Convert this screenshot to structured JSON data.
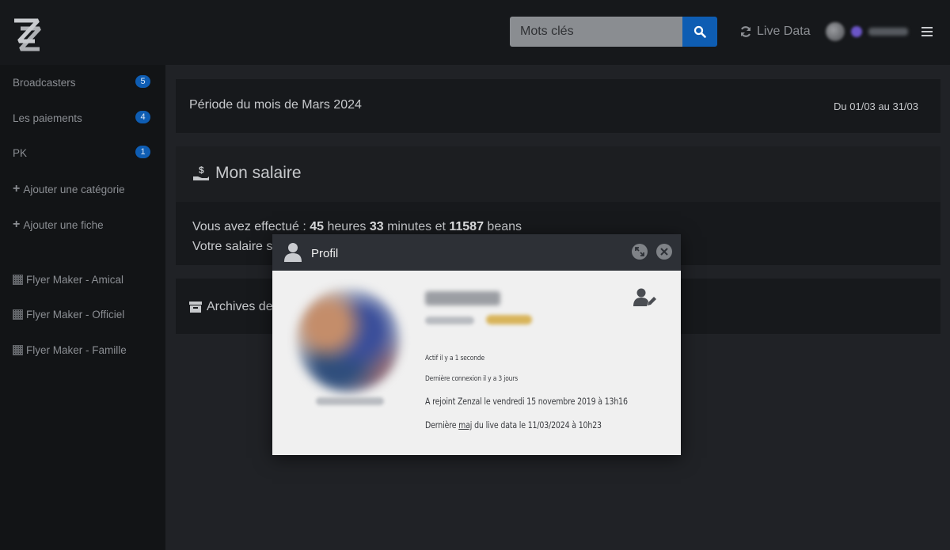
{
  "header": {
    "search": {
      "placeholder": "Mots clés"
    },
    "live_data_label": "Live Data"
  },
  "sidebar": {
    "items": [
      {
        "label": "Broadcasters",
        "badge": "5"
      },
      {
        "label": "Les paiements",
        "badge": "4"
      },
      {
        "label": "PK",
        "badge": "1"
      },
      {
        "label": "Ajouter une catégorie"
      },
      {
        "label": "Ajouter une fiche"
      },
      {
        "label": "Flyer Maker - Amical"
      },
      {
        "label": "Flyer Maker - Officiel"
      },
      {
        "label": "Flyer Maker - Famille"
      }
    ]
  },
  "period": {
    "title": "Période du mois de Mars 2024",
    "range": "Du 01/03 au 31/03"
  },
  "salary": {
    "title": "Mon salaire",
    "line1_prefix": "Vous avez effectué : ",
    "hours": "45",
    "hours_label": " heures ",
    "minutes": "33",
    "minutes_label": " minutes et ",
    "beans": "11587",
    "beans_label": " beans",
    "line2": "Votre salaire s"
  },
  "archives": {
    "title": "Archives de"
  },
  "modal": {
    "title": "Profil",
    "active": "Actif il y a 1 seconde",
    "last_login": "Dernière connexion il y a 3 jours",
    "joined": "A rejoint Zenzal le vendredi 15 novembre 2019 à 13h16",
    "last_update_prefix": "Dernière ",
    "last_update_maj": "maj",
    "last_update_suffix": " du live data le 11/03/2024 à 10h23"
  },
  "colors": {
    "accent": "#0e5db3",
    "topbar": "#16181b",
    "sidebar": "#121416",
    "modal_header": "#2d3036"
  }
}
